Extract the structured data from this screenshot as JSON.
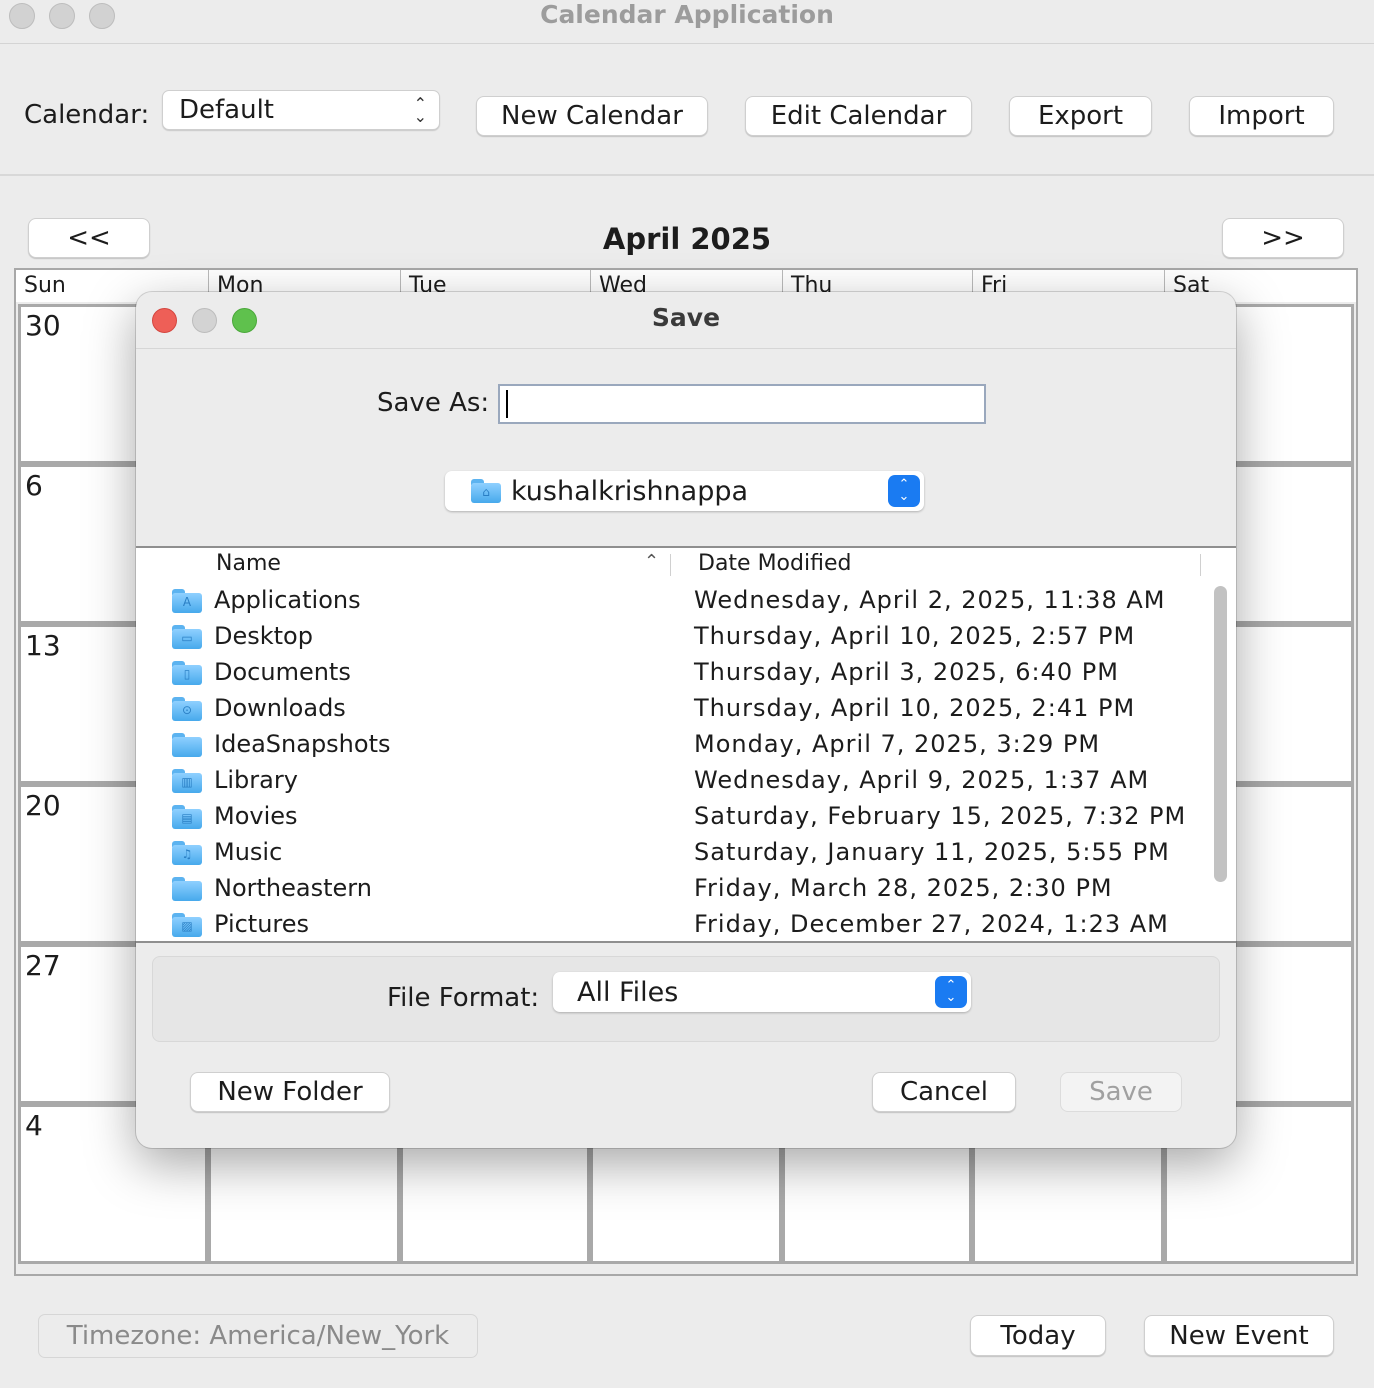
{
  "window": {
    "title": "Calendar Application"
  },
  "toolbar": {
    "calendar_label": "Calendar:",
    "calendar_selected": "Default",
    "new_calendar": "New Calendar",
    "edit_calendar": "Edit Calendar",
    "export": "Export",
    "import": "Import"
  },
  "nav": {
    "prev": "<<",
    "next": ">>",
    "month_title": "April 2025"
  },
  "calendar": {
    "day_headers": [
      "Sun",
      "Mon",
      "Tue",
      "Wed",
      "Thu",
      "Fri",
      "Sat"
    ],
    "week_start_dates": [
      "30",
      "6",
      "13",
      "20",
      "27",
      "4"
    ]
  },
  "footer": {
    "timezone": "Timezone: America/New_York",
    "today": "Today",
    "new_event": "New Event"
  },
  "dialog": {
    "title": "Save",
    "save_as_label": "Save As:",
    "save_as_value": "",
    "location": "kushalkrishnappa",
    "columns": {
      "name": "Name",
      "date_modified": "Date Modified"
    },
    "files": [
      {
        "name": "Applications",
        "date": "Wednesday, April 2, 2025, 11:38 AM",
        "icon": "A"
      },
      {
        "name": "Desktop",
        "date": "Thursday, April 10, 2025, 2:57 PM",
        "icon": "▭"
      },
      {
        "name": "Documents",
        "date": "Thursday, April 3, 2025, 6:40 PM",
        "icon": "▯"
      },
      {
        "name": "Downloads",
        "date": "Thursday, April 10, 2025, 2:41 PM",
        "icon": "⊙"
      },
      {
        "name": "IdeaSnapshots",
        "date": "Monday, April 7, 2025, 3:29 PM",
        "icon": ""
      },
      {
        "name": "Library",
        "date": "Wednesday, April 9, 2025, 1:37 AM",
        "icon": "▥"
      },
      {
        "name": "Movies",
        "date": "Saturday, February 15, 2025, 7:32 PM",
        "icon": "▤"
      },
      {
        "name": "Music",
        "date": "Saturday, January 11, 2025, 5:55 PM",
        "icon": "♫"
      },
      {
        "name": "Northeastern",
        "date": "Friday, March 28, 2025, 2:30 PM",
        "icon": ""
      },
      {
        "name": "Pictures",
        "date": "Friday, December 27, 2024, 1:23 AM",
        "icon": "▨"
      }
    ],
    "file_format_label": "File Format:",
    "file_format_value": "All Files",
    "new_folder": "New Folder",
    "cancel": "Cancel",
    "save": "Save"
  },
  "colors": {
    "accent": "#1a7bf2",
    "close": "#ee5f57",
    "zoom": "#5fc14d"
  }
}
